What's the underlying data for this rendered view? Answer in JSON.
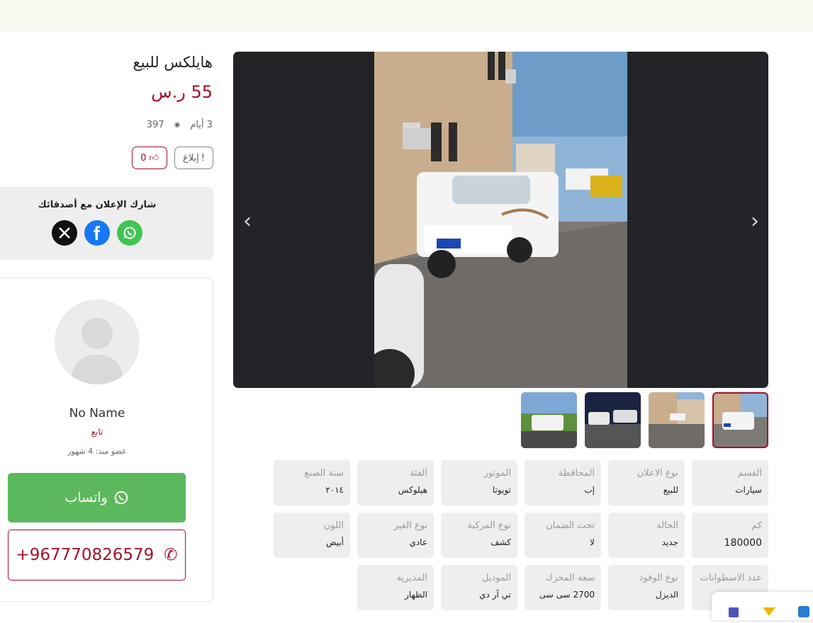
{
  "ad": {
    "title": "هايلكس للبيع",
    "price": "55 ر.س",
    "views": "397",
    "age": "3 أيام",
    "report_label": "إبلاغ",
    "likes": "0"
  },
  "share": {
    "title": "شارك الإعلان مع أصدقائك",
    "networks": [
      "x-icon",
      "facebook-icon",
      "whatsapp-icon"
    ]
  },
  "seller": {
    "name": "No Name",
    "role": "تابع",
    "member_since": "عضو منذ: 4 شهور",
    "whatsapp_label": "واتساب",
    "phone": "+967770826579"
  },
  "gallery": {
    "thumb_count": 4,
    "active_index": 0
  },
  "specs": [
    {
      "label": "القسم",
      "value": "سيارات"
    },
    {
      "label": "نوع الاعلان",
      "value": "للبيع"
    },
    {
      "label": "المحافظة",
      "value": "إب"
    },
    {
      "label": "الموتور",
      "value": "تويوتا"
    },
    {
      "label": "الفئة",
      "value": "هيلوكس"
    },
    {
      "label": "سنة الصنع",
      "value": "٢٠١٤"
    },
    {
      "label": "كم",
      "value": "180000"
    },
    {
      "label": "الحالة",
      "value": "جديد"
    },
    {
      "label": "تحت الضمان",
      "value": "لا"
    },
    {
      "label": "نوع المركبة",
      "value": "كشف"
    },
    {
      "label": "نوع القير",
      "value": "عادي"
    },
    {
      "label": "اللون",
      "value": "أبيض"
    },
    {
      "label": "عدد الاسطوانات",
      "value": ""
    },
    {
      "label": "نوع الوقود",
      "value": "الديزل"
    },
    {
      "label": "سعة المحرك",
      "value": "2700 سى سى"
    },
    {
      "label": "الموديل",
      "value": "تي آر دي"
    },
    {
      "label": "المديرية",
      "value": "الظهار"
    }
  ],
  "colors": {
    "accent": "#a3102b",
    "whatsapp": "#5cb85c",
    "gallery_bg": "#222428",
    "tile_bg": "#eeeeee"
  }
}
